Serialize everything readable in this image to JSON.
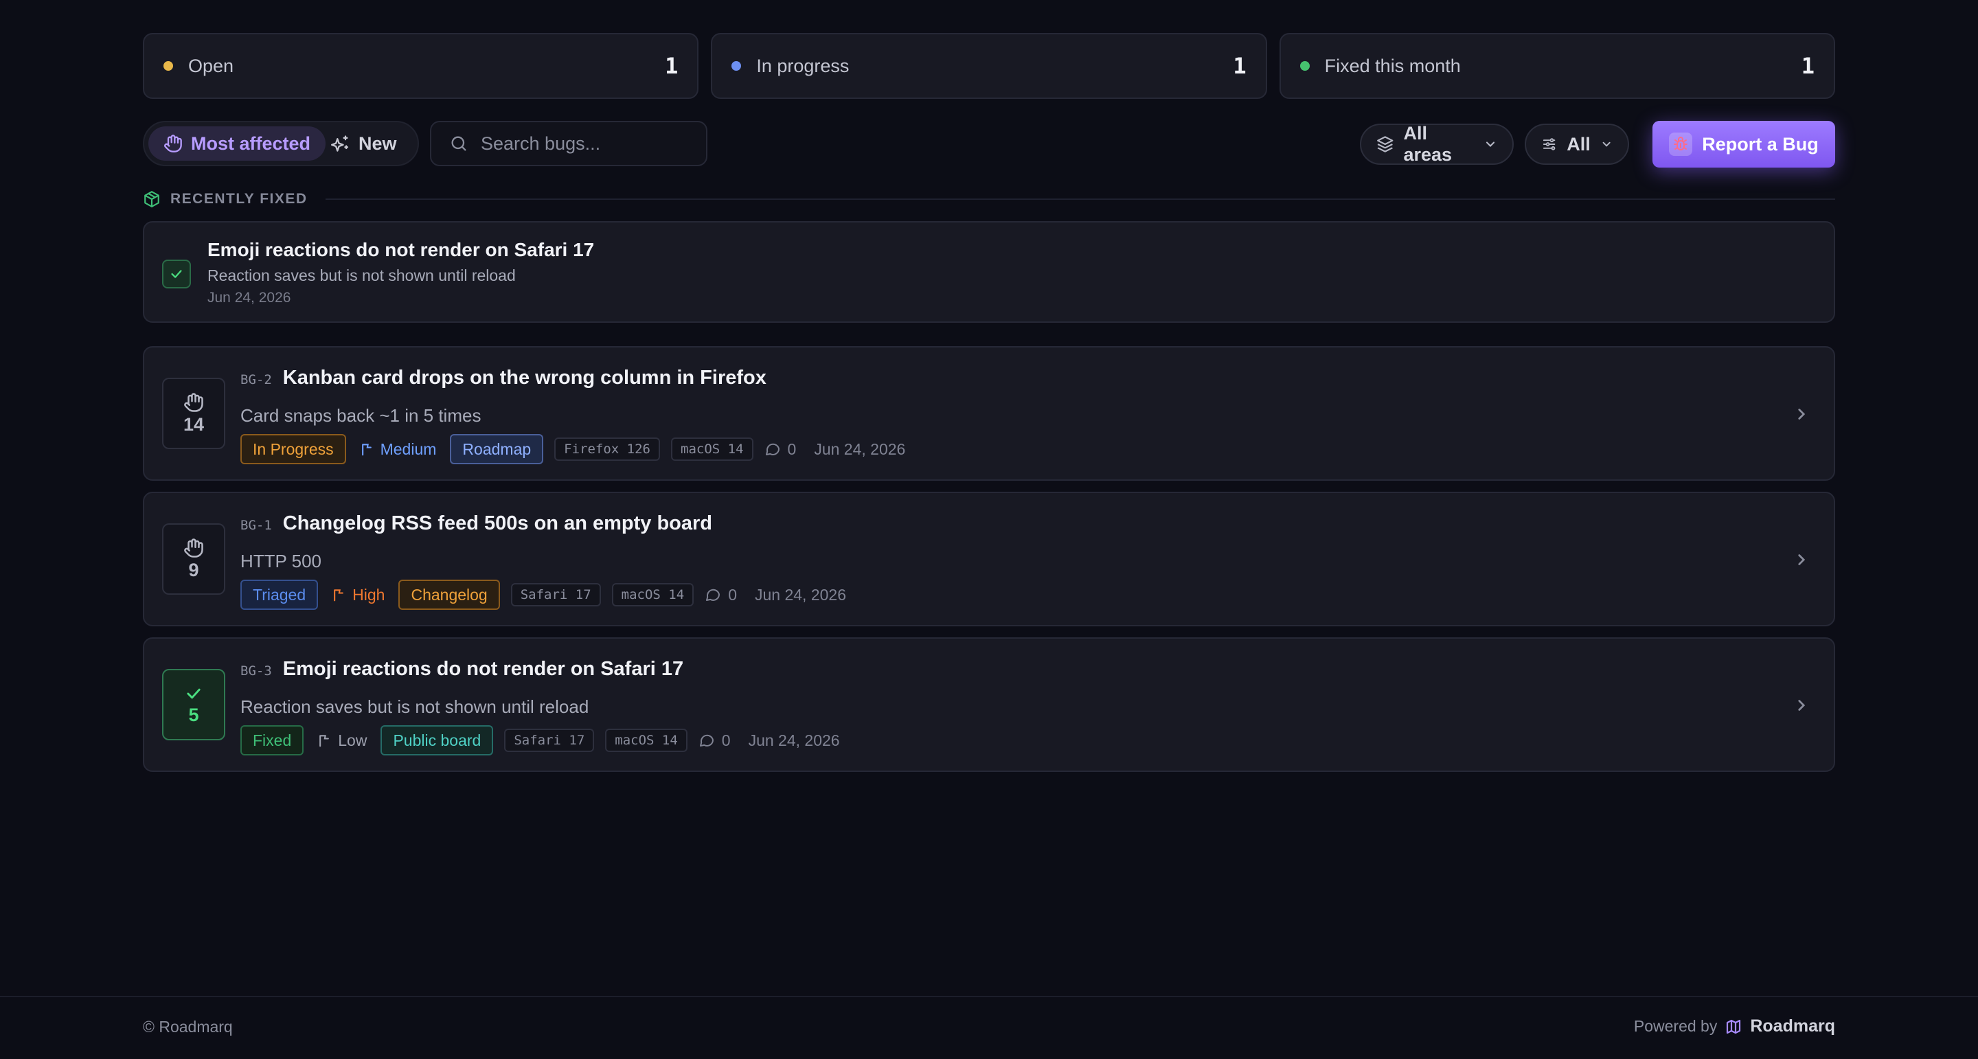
{
  "stats": [
    {
      "label": "Open",
      "count": "1",
      "color": "#e9b84a"
    },
    {
      "label": "In progress",
      "count": "1",
      "color": "#6d8ff0"
    },
    {
      "label": "Fixed this month",
      "count": "1",
      "color": "#46c26f"
    }
  ],
  "toolbar": {
    "most_affected": "Most affected",
    "new": "New",
    "search_placeholder": "Search bugs...",
    "areas": "All areas",
    "filter": "All",
    "report": "Report a Bug"
  },
  "recently_fixed": {
    "heading": "RECENTLY FIXED",
    "title": "Emoji reactions do not render on Safari 17",
    "description": "Reaction saves but is not shown until reload",
    "date": "Jun 24, 2026"
  },
  "bugs": [
    {
      "key": "BG-2",
      "title": "Kanban card drops on the wrong column in Firefox",
      "description": "Card snaps back ~1 in 5 times",
      "votes": "14",
      "status": "In Progress",
      "priority": "Medium",
      "area": "Roadmap",
      "browser": "Firefox 126",
      "os": "macOS 14",
      "comments": "0",
      "date": "Jun 24, 2026"
    },
    {
      "key": "BG-1",
      "title": "Changelog RSS feed 500s on an empty board",
      "description": "HTTP 500",
      "votes": "9",
      "status": "Triaged",
      "priority": "High",
      "area": "Changelog",
      "browser": "Safari 17",
      "os": "macOS 14",
      "comments": "0",
      "date": "Jun 24, 2026"
    },
    {
      "key": "BG-3",
      "title": "Emoji reactions do not render on Safari 17",
      "description": "Reaction saves but is not shown until reload",
      "votes": "5",
      "status": "Fixed",
      "priority": "Low",
      "area": "Public board",
      "browser": "Safari 17",
      "os": "macOS 14",
      "comments": "0",
      "date": "Jun 24, 2026"
    }
  ],
  "footer": {
    "copyright": "© Roadmarq",
    "powered_by": "Powered by",
    "brand": "Roadmarq"
  },
  "colors": {
    "accent": "#8b63f5",
    "in_progress": "#f0a23a",
    "triaged": "#5b8def",
    "fixed": "#3fbf77",
    "medium": "#6fa0ff",
    "high": "#f0782f",
    "low": "#9ea1af"
  }
}
